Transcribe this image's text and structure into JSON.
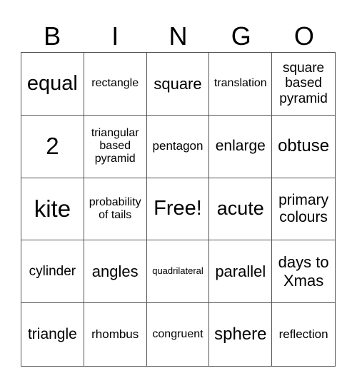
{
  "header": [
    "B",
    "I",
    "N",
    "G",
    "O"
  ],
  "cells": [
    "equal",
    "rectangle",
    "square",
    "translation",
    "square based pyramid",
    "2",
    "triangular based pyramid",
    "pentagon",
    "enlarge",
    "obtuse",
    "kite",
    "probability of tails",
    "Free!",
    "acute",
    "primary colours",
    "cylinder",
    "angles",
    "quadrilateral",
    "parallel",
    "days to Xmas",
    "triangle",
    "rhombus",
    "congruent",
    "sphere",
    "reflection"
  ]
}
